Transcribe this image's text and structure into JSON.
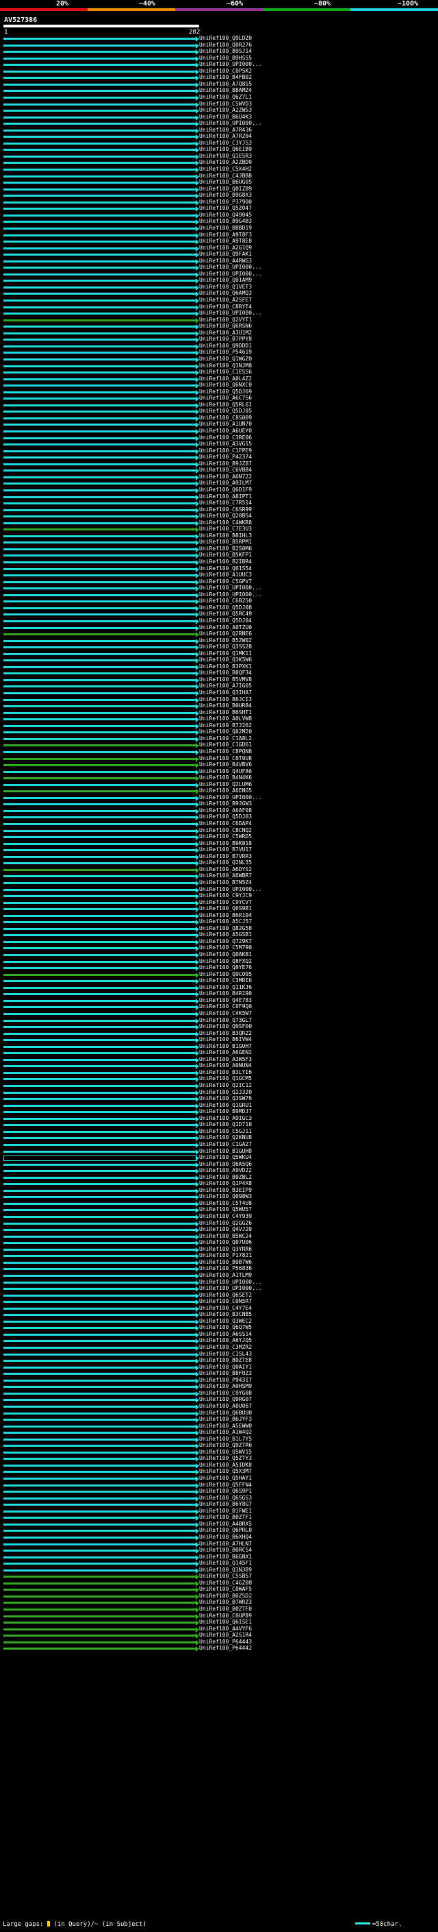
{
  "scale": {
    "labels": [
      "20%",
      "~40%",
      "~60%",
      "~80%",
      "~100%"
    ],
    "colors": [
      "#dd1111",
      "#ee8800",
      "#993399",
      "#11aa11",
      "#22ccdd"
    ]
  },
  "query": {
    "name": "AV527386",
    "start": "1",
    "end": "282"
  },
  "hit_colors": {
    "cyan": "#22dddd",
    "green": "#33aa22",
    "black": "#000000"
  },
  "chart_data": {
    "type": "alignment-overview",
    "query_length": 282,
    "hits": [
      {
        "label": "UniRef100_Q9LDZ0",
        "color": "cyan"
      },
      {
        "label": "UniRef100_Q0R276",
        "color": "cyan"
      },
      {
        "label": "UniRef100_B9SJ14",
        "color": "cyan"
      },
      {
        "label": "UniRef100_B9HS55",
        "color": "cyan"
      },
      {
        "label": "UniRef100_UPI000...",
        "color": "cyan"
      },
      {
        "label": "UniRef100_C0PSK2",
        "color": "cyan"
      },
      {
        "label": "UniRef100_B4FB02",
        "color": "cyan"
      },
      {
        "label": "UniRef100_A7Q8S5",
        "color": "cyan"
      },
      {
        "label": "UniRef100_B8AMZ4",
        "color": "cyan"
      },
      {
        "label": "UniRef100_Q6Z7L1",
        "color": "cyan"
      },
      {
        "label": "UniRef100_C5WVD3",
        "color": "cyan"
      },
      {
        "label": "UniRef100_A2ZWS3",
        "color": "cyan"
      },
      {
        "label": "UniRef100_B6U4K3",
        "color": "cyan"
      },
      {
        "label": "UniRef100_UPI000...",
        "color": "cyan"
      },
      {
        "label": "UniRef100_A7R436",
        "color": "cyan"
      },
      {
        "label": "UniRef100_A7R204",
        "color": "cyan"
      },
      {
        "label": "UniRef100_C3YJS3",
        "color": "cyan"
      },
      {
        "label": "UniRef100_Q6EIB9",
        "color": "cyan"
      },
      {
        "label": "UniRef100_Q1ESR3",
        "color": "cyan"
      },
      {
        "label": "UniRef100_A2ZBD0",
        "color": "cyan"
      },
      {
        "label": "UniRef100_C5X4H2",
        "color": "cyan"
      },
      {
        "label": "UniRef100_C4JBB8",
        "color": "cyan"
      },
      {
        "label": "UniRef100_B6UG05",
        "color": "cyan"
      },
      {
        "label": "UniRef100_Q0IZB9",
        "color": "cyan"
      },
      {
        "label": "UniRef100_B9G8X3",
        "color": "cyan"
      },
      {
        "label": "UniRef100_P37900",
        "color": "cyan"
      },
      {
        "label": "UniRef100_Q5Z047",
        "color": "cyan"
      },
      {
        "label": "UniRef100_Q49045",
        "color": "cyan"
      },
      {
        "label": "UniRef100_B9G4B3",
        "color": "cyan"
      },
      {
        "label": "UniRef100_B8BD19",
        "color": "cyan"
      },
      {
        "label": "UniRef100_A9T8F3",
        "color": "cyan"
      },
      {
        "label": "UniRef100_A9T8E8",
        "color": "cyan"
      },
      {
        "label": "UniRef100_A2G1Q9",
        "color": "cyan"
      },
      {
        "label": "UniRef100_Q9FAK1",
        "color": "cyan"
      },
      {
        "label": "UniRef100_A4RWG3",
        "color": "cyan"
      },
      {
        "label": "UniRef100_UPI000...",
        "color": "cyan"
      },
      {
        "label": "UniRef100_UPI000...",
        "color": "cyan"
      },
      {
        "label": "UniRef100_Q01AM9",
        "color": "cyan"
      },
      {
        "label": "UniRef100_Q1VET3",
        "color": "cyan"
      },
      {
        "label": "UniRef100_Q6AMQ3",
        "color": "cyan"
      },
      {
        "label": "UniRef100_A2SFE7",
        "color": "cyan"
      },
      {
        "label": "UniRef100_C8RYT4",
        "color": "cyan"
      },
      {
        "label": "UniRef100_UPI000...",
        "color": "cyan"
      },
      {
        "label": "UniRef100_Q2VYT1",
        "color": "green"
      },
      {
        "label": "UniRef100_Q6RSN6",
        "color": "cyan"
      },
      {
        "label": "UniRef100_A3U1M2",
        "color": "cyan"
      },
      {
        "label": "UniRef100_B7PPY8",
        "color": "cyan"
      },
      {
        "label": "UniRef100_Q9DDD1",
        "color": "cyan"
      },
      {
        "label": "UniRef100_P54619",
        "color": "cyan"
      },
      {
        "label": "UniRef100_Q1WGZ0",
        "color": "cyan"
      },
      {
        "label": "UniRef100_Q1NJM8",
        "color": "cyan"
      },
      {
        "label": "UniRef100_C1ESS6",
        "color": "cyan"
      },
      {
        "label": "UniRef100_A0L4Z2",
        "color": "cyan"
      },
      {
        "label": "UniRef100_Q6NXC0",
        "color": "cyan"
      },
      {
        "label": "UniRef100_Q5DJ69",
        "color": "cyan"
      },
      {
        "label": "UniRef100_A6C7S6",
        "color": "cyan"
      },
      {
        "label": "UniRef100_Q5RL61",
        "color": "cyan"
      },
      {
        "label": "UniRef100_Q5DJ05",
        "color": "cyan"
      },
      {
        "label": "UniRef100_C8S009",
        "color": "cyan"
      },
      {
        "label": "UniRef100_A1UN70",
        "color": "cyan"
      },
      {
        "label": "UniRef100_A6UEY0",
        "color": "cyan"
      },
      {
        "label": "UniRef100_C3RE06",
        "color": "cyan"
      },
      {
        "label": "UniRef100_A3VG15",
        "color": "cyan"
      },
      {
        "label": "UniRef100_C1FPE9",
        "color": "cyan"
      },
      {
        "label": "UniRef100_P42374",
        "color": "cyan"
      },
      {
        "label": "UniRef100_B9JZ87",
        "color": "cyan"
      },
      {
        "label": "UniRef100_C6VB84",
        "color": "cyan"
      },
      {
        "label": "UniRef100_A6N722",
        "color": "cyan"
      },
      {
        "label": "UniRef100_A9ILM7",
        "color": "cyan"
      },
      {
        "label": "UniRef100_Q6D1F9",
        "color": "cyan"
      },
      {
        "label": "UniRef100_A8IPT1",
        "color": "cyan"
      },
      {
        "label": "UniRef100_C7R514",
        "color": "cyan"
      },
      {
        "label": "UniRef100_C6SR99",
        "color": "cyan"
      },
      {
        "label": "UniRef100_Q20BS4",
        "color": "cyan"
      },
      {
        "label": "UniRef100_C4WKR8",
        "color": "cyan"
      },
      {
        "label": "UniRef100_C7E3U3",
        "color": "green"
      },
      {
        "label": "UniRef100_B8IHL3",
        "color": "cyan"
      },
      {
        "label": "UniRef100_B5RPM1",
        "color": "cyan"
      },
      {
        "label": "UniRef100_B2S0M6",
        "color": "cyan"
      },
      {
        "label": "UniRef100_B5KFP1",
        "color": "cyan"
      },
      {
        "label": "UniRef100_B2IBR4",
        "color": "cyan"
      },
      {
        "label": "UniRef100_Q61S54",
        "color": "cyan"
      },
      {
        "label": "UniRef100_A1UUC3",
        "color": "cyan"
      },
      {
        "label": "UniRef100_C5GPV7",
        "color": "cyan"
      },
      {
        "label": "UniRef100_UPI000...",
        "color": "cyan"
      },
      {
        "label": "UniRef100_UPI000...",
        "color": "cyan"
      },
      {
        "label": "UniRef100_C6B250",
        "color": "cyan"
      },
      {
        "label": "UniRef100_Q5DJ08",
        "color": "cyan"
      },
      {
        "label": "UniRef100_Q5RC49",
        "color": "cyan"
      },
      {
        "label": "UniRef100_Q5DJ04",
        "color": "cyan"
      },
      {
        "label": "UniRef100_A0TZU0",
        "color": "cyan"
      },
      {
        "label": "UniRef100_Q2RNE6",
        "color": "green"
      },
      {
        "label": "UniRef100_B5ZW02",
        "color": "cyan"
      },
      {
        "label": "UniRef100_Q3SS28",
        "color": "cyan"
      },
      {
        "label": "UniRef100_Q1MK11",
        "color": "cyan"
      },
      {
        "label": "UniRef100_Q3K5W6",
        "color": "cyan"
      },
      {
        "label": "UniRef100_B3PXK1",
        "color": "cyan"
      },
      {
        "label": "UniRef100_B8QF34",
        "color": "cyan"
      },
      {
        "label": "UniRef100_B5VMV8",
        "color": "cyan"
      },
      {
        "label": "UniRef100_A7IG05",
        "color": "cyan"
      },
      {
        "label": "UniRef100_Q3IHA7",
        "color": "cyan"
      },
      {
        "label": "UniRef100_B6JCI3",
        "color": "cyan"
      },
      {
        "label": "UniRef100_B0UR84",
        "color": "cyan"
      },
      {
        "label": "UniRef100_B6SHT1",
        "color": "cyan"
      },
      {
        "label": "UniRef100_A0LVW8",
        "color": "cyan"
      },
      {
        "label": "UniRef100_B7J262",
        "color": "cyan"
      },
      {
        "label": "UniRef100_Q02M20",
        "color": "cyan"
      },
      {
        "label": "UniRef100_C1A8L2",
        "color": "cyan"
      },
      {
        "label": "UniRef100_C1GD61",
        "color": "green"
      },
      {
        "label": "UniRef100_C8PQN8",
        "color": "cyan"
      },
      {
        "label": "UniRef100_C0T0U8",
        "color": "green"
      },
      {
        "label": "UniRef100_B4VBV6",
        "color": "green"
      },
      {
        "label": "UniRef100_Q4UFA6",
        "color": "cyan"
      },
      {
        "label": "UniRef100_B4N4K6",
        "color": "green"
      },
      {
        "label": "UniRef100_Q2LUM6",
        "color": "cyan"
      },
      {
        "label": "UniRef100_A6ENO5",
        "color": "green"
      },
      {
        "label": "UniRef100_UPI000...",
        "color": "cyan"
      },
      {
        "label": "UniRef100_B9JGW3",
        "color": "cyan"
      },
      {
        "label": "UniRef100_A6AF08",
        "color": "cyan"
      },
      {
        "label": "UniRef100_Q5DJ03",
        "color": "cyan"
      },
      {
        "label": "UniRef100_C6DAP4",
        "color": "cyan"
      },
      {
        "label": "UniRef100_C8CNQ2",
        "color": "cyan"
      },
      {
        "label": "UniRef100_C5WRD5",
        "color": "cyan"
      },
      {
        "label": "UniRef100_B9K818",
        "color": "cyan"
      },
      {
        "label": "UniRef100_B7VU17",
        "color": "cyan"
      },
      {
        "label": "UniRef100_B7VRR3",
        "color": "cyan"
      },
      {
        "label": "UniRef100_Q2NL35",
        "color": "cyan"
      },
      {
        "label": "UniRef100_A6DYS2",
        "color": "green"
      },
      {
        "label": "UniRef100_A6WBR7",
        "color": "cyan"
      },
      {
        "label": "UniRef100_B7N5Z4",
        "color": "cyan"
      },
      {
        "label": "UniRef100_UPI000...",
        "color": "cyan"
      },
      {
        "label": "UniRef100_C9YJC9",
        "color": "cyan"
      },
      {
        "label": "UniRef100_C9YCV7",
        "color": "cyan"
      },
      {
        "label": "UniRef100_Q6S981",
        "color": "cyan"
      },
      {
        "label": "UniRef100_B6R194",
        "color": "cyan"
      },
      {
        "label": "UniRef100_A5CJ57",
        "color": "cyan"
      },
      {
        "label": "UniRef100_Q82G58",
        "color": "cyan"
      },
      {
        "label": "UniRef100_A5GS81",
        "color": "cyan"
      },
      {
        "label": "UniRef100_Q729K7",
        "color": "cyan"
      },
      {
        "label": "UniRef100_C5M790",
        "color": "cyan"
      },
      {
        "label": "UniRef100_Q0AKB1",
        "color": "cyan"
      },
      {
        "label": "UniRef100_Q8FXQ2",
        "color": "cyan"
      },
      {
        "label": "UniRef100_Q8YE76",
        "color": "cyan"
      },
      {
        "label": "UniRef100_Q0C095",
        "color": "green"
      },
      {
        "label": "UniRef100_C3MRI6",
        "color": "cyan"
      },
      {
        "label": "UniRef100_Q11KJ6",
        "color": "cyan"
      },
      {
        "label": "UniRef100_B4R190",
        "color": "cyan"
      },
      {
        "label": "UniRef100_Q4E783",
        "color": "cyan"
      },
      {
        "label": "UniRef100_C0F9Q0",
        "color": "cyan"
      },
      {
        "label": "UniRef100_C4K5W7",
        "color": "cyan"
      },
      {
        "label": "UniRef100_Q73GL7",
        "color": "cyan"
      },
      {
        "label": "UniRef100_Q0SF00",
        "color": "cyan"
      },
      {
        "label": "UniRef100_B3QRZ2",
        "color": "cyan"
      },
      {
        "label": "UniRef100_B6IVW4",
        "color": "cyan"
      },
      {
        "label": "UniRef100_B1GUH7",
        "color": "cyan"
      },
      {
        "label": "UniRef100_A6GEN2",
        "color": "cyan"
      },
      {
        "label": "UniRef100_A3W5F3",
        "color": "cyan"
      },
      {
        "label": "UniRef100_A0NUN4",
        "color": "cyan"
      },
      {
        "label": "UniRef100_B3LYI6",
        "color": "cyan"
      },
      {
        "label": "UniRef100_Q1GCM5",
        "color": "cyan"
      },
      {
        "label": "UniRef100_Q2IC12",
        "color": "cyan"
      },
      {
        "label": "UniRef100_Q2J320",
        "color": "cyan"
      },
      {
        "label": "UniRef100_Q3SW76",
        "color": "cyan"
      },
      {
        "label": "UniRef100_Q1GRU1",
        "color": "cyan"
      },
      {
        "label": "UniRef100_B9MDJ7",
        "color": "cyan"
      },
      {
        "label": "UniRef100_A9IGC3",
        "color": "cyan"
      },
      {
        "label": "UniRef100_Q1D710",
        "color": "cyan"
      },
      {
        "label": "UniRef100_C5GJ11",
        "color": "cyan"
      },
      {
        "label": "UniRef100_Q2KNU8",
        "color": "cyan"
      },
      {
        "label": "UniRef100_C1GA27",
        "color": "cyan"
      },
      {
        "label": "UniRef100_B1GUH8",
        "color": "cyan"
      },
      {
        "label": "UniRef100_Q5WKU4",
        "color": "black"
      },
      {
        "label": "UniRef100_Q6A5Q6",
        "color": "cyan"
      },
      {
        "label": "UniRef100_A9VD22",
        "color": "cyan"
      },
      {
        "label": "UniRef100_B0ZBL2",
        "color": "cyan"
      },
      {
        "label": "UniRef100_Q1P4X8",
        "color": "cyan"
      },
      {
        "label": "UniRef100_B3EIP9",
        "color": "cyan"
      },
      {
        "label": "UniRef100_Q098W3",
        "color": "cyan"
      },
      {
        "label": "UniRef100_C5T4U8",
        "color": "cyan"
      },
      {
        "label": "UniRef100_Q5WU57",
        "color": "cyan"
      },
      {
        "label": "UniRef100_C4Y939",
        "color": "cyan"
      },
      {
        "label": "UniRef100_Q2GG26",
        "color": "cyan"
      },
      {
        "label": "UniRef100_Q4VJ20",
        "color": "cyan"
      },
      {
        "label": "UniRef100_B5WC24",
        "color": "cyan"
      },
      {
        "label": "UniRef100_Q07U06",
        "color": "cyan"
      },
      {
        "label": "UniRef100_Q3YRR6",
        "color": "cyan"
      },
      {
        "label": "UniRef100_P17821",
        "color": "cyan"
      },
      {
        "label": "UniRef100_B0B7W6",
        "color": "cyan"
      },
      {
        "label": "UniRef100_P56836",
        "color": "cyan"
      },
      {
        "label": "UniRef100_A1TLM9",
        "color": "cyan"
      },
      {
        "label": "UniRef100_UPI000...",
        "color": "cyan"
      },
      {
        "label": "UniRef100_UPI000...",
        "color": "cyan"
      },
      {
        "label": "UniRef100_Q6SET2",
        "color": "cyan"
      },
      {
        "label": "UniRef100_C0N5R7",
        "color": "cyan"
      },
      {
        "label": "UniRef100_C4Y7E4",
        "color": "cyan"
      },
      {
        "label": "UniRef100_B3CNB5",
        "color": "cyan"
      },
      {
        "label": "UniRef100_Q3WEC2",
        "color": "cyan"
      },
      {
        "label": "UniRef100_Q6Q7W5",
        "color": "cyan"
      },
      {
        "label": "UniRef100_A6SS14",
        "color": "cyan"
      },
      {
        "label": "UniRef100_A6YJQ5",
        "color": "cyan"
      },
      {
        "label": "UniRef100_C3MZR2",
        "color": "cyan"
      },
      {
        "label": "UniRef100_C1SL43",
        "color": "cyan"
      },
      {
        "label": "UniRef100_B0ZTE8",
        "color": "cyan"
      },
      {
        "label": "UniRef100_Q0AIY1",
        "color": "cyan"
      },
      {
        "label": "UniRef100_B8F0Z3",
        "color": "cyan"
      },
      {
        "label": "UniRef100_P94317",
        "color": "cyan"
      },
      {
        "label": "UniRef100_A0HSM9",
        "color": "cyan"
      },
      {
        "label": "UniRef100_C9YG08",
        "color": "cyan"
      },
      {
        "label": "UniRef100_Q9RG07",
        "color": "cyan"
      },
      {
        "label": "UniRef100_A8U067",
        "color": "cyan"
      },
      {
        "label": "UniRef100_Q6BUU0",
        "color": "cyan"
      },
      {
        "label": "UniRef100_B6JYF3",
        "color": "cyan"
      },
      {
        "label": "UniRef100_A5EWW0",
        "color": "cyan"
      },
      {
        "label": "UniRef100_A1W4Q2",
        "color": "cyan"
      },
      {
        "label": "UniRef100_B1L7Y5",
        "color": "cyan"
      },
      {
        "label": "UniRef100_Q9ZTR6",
        "color": "cyan"
      },
      {
        "label": "UniRef100_Q5WV15",
        "color": "cyan"
      },
      {
        "label": "UniRef100_Q5ZTY3",
        "color": "cyan"
      },
      {
        "label": "UniRef100_A5IDK8",
        "color": "cyan"
      },
      {
        "label": "UniRef100_Q5X3M7",
        "color": "cyan"
      },
      {
        "label": "UniRef100_Q5HAY1",
        "color": "cyan"
      },
      {
        "label": "UniRef100_Q5FFN4",
        "color": "cyan"
      },
      {
        "label": "UniRef100_Q6S9P1",
        "color": "cyan"
      },
      {
        "label": "UniRef100_Q6SGS3",
        "color": "cyan"
      },
      {
        "label": "UniRef100_B6Y8G7",
        "color": "cyan"
      },
      {
        "label": "UniRef100_B1FWE1",
        "color": "cyan"
      },
      {
        "label": "UniRef100_B0ZTF1",
        "color": "cyan"
      },
      {
        "label": "UniRef100_A4BRX5",
        "color": "cyan"
      },
      {
        "label": "UniRef100_Q6PRL0",
        "color": "cyan"
      },
      {
        "label": "UniRef100_B6XHQ4",
        "color": "cyan"
      },
      {
        "label": "UniRef100_A7HLN7",
        "color": "cyan"
      },
      {
        "label": "UniRef100_B0RCS4",
        "color": "cyan"
      },
      {
        "label": "UniRef100_B6GNX1",
        "color": "cyan"
      },
      {
        "label": "UniRef100_Q145F1",
        "color": "cyan"
      },
      {
        "label": "UniRef100_Q1N389",
        "color": "cyan"
      },
      {
        "label": "UniRef100_C5SBS7",
        "color": "green"
      },
      {
        "label": "UniRef100_C4GZ08",
        "color": "green"
      },
      {
        "label": "UniRef100_C0WAF5",
        "color": "green"
      },
      {
        "label": "UniRef100_B0ZSD2",
        "color": "green"
      },
      {
        "label": "UniRef100_B7WRZ3",
        "color": "green"
      },
      {
        "label": "UniRef100_B0ZTF0",
        "color": "green"
      },
      {
        "label": "UniRef100_C0UP89",
        "color": "green"
      },
      {
        "label": "UniRef100_Q6ISE1",
        "color": "green"
      },
      {
        "label": "UniRef100_A4VYF6",
        "color": "green"
      },
      {
        "label": "UniRef100_A2S1R4",
        "color": "green"
      },
      {
        "label": "UniRef100_P64443",
        "color": "green"
      },
      {
        "label": "UniRef100_P64442",
        "color": "green"
      }
    ]
  },
  "footer": {
    "gaps_prefix": "Large gaps:",
    "gaps_suffix": "(in Query)/~ (in Subject)",
    "legend": "=50char."
  }
}
